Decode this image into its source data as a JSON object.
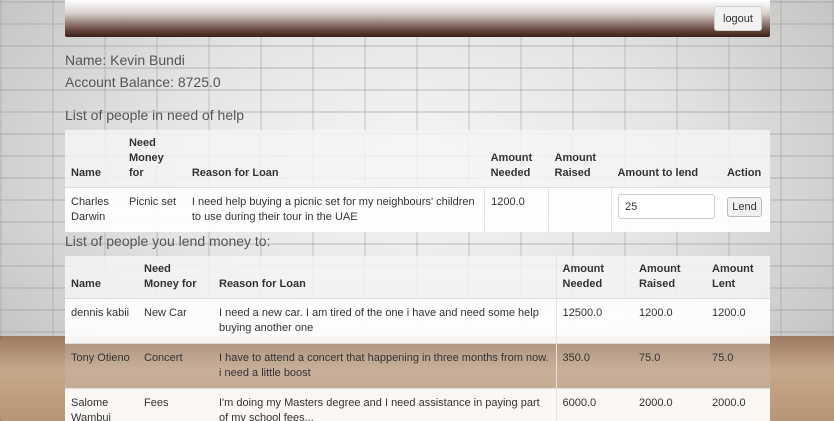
{
  "header": {
    "logout_label": "logout"
  },
  "user": {
    "name_line": "Name: Kevin Bundi",
    "balance_line": "Account Balance: 8725.0"
  },
  "need_help": {
    "title": "List of people in need of help",
    "columns": [
      "Name",
      "Need Money for",
      "Reason for Loan",
      "Amount Needed",
      "Amount Raised",
      "Amount to lend",
      "Action"
    ],
    "rows": [
      {
        "name": "Charles Darwin",
        "need_for": "Picnic set",
        "reason": "I need help buying a picnic set for my neighbours' children to use during their tour in the UAE",
        "amount_needed": "1200.0",
        "amount_raised": "",
        "amount_to_lend": "25",
        "action_label": "Lend"
      }
    ]
  },
  "lent_to": {
    "title": "List of people you lend money to:",
    "columns": [
      "Name",
      "Need Money for",
      "Reason for Loan",
      "Amount Needed",
      "Amount Raised",
      "Amount Lent"
    ],
    "rows": [
      {
        "name": "dennis kabii",
        "need_for": "New Car",
        "reason": "I need a new car. I am tired of the one i have and need some help buying another one",
        "amount_needed": "12500.0",
        "amount_raised": "1200.0",
        "amount_lent": "1200.0"
      },
      {
        "name": "Tony Otieno",
        "need_for": "Concert",
        "reason": "I have to attend a concert that happening in three months from now. i need a little boost",
        "amount_needed": "350.0",
        "amount_raised": "75.0",
        "amount_lent": "75.0"
      },
      {
        "name": "Salome Wambui",
        "need_for": "Fees",
        "reason": "I'm doing my Masters degree and I need assistance in paying part of my school fees...",
        "amount_needed": "6000.0",
        "amount_raised": "2000.0",
        "amount_lent": "2000.0"
      }
    ]
  }
}
